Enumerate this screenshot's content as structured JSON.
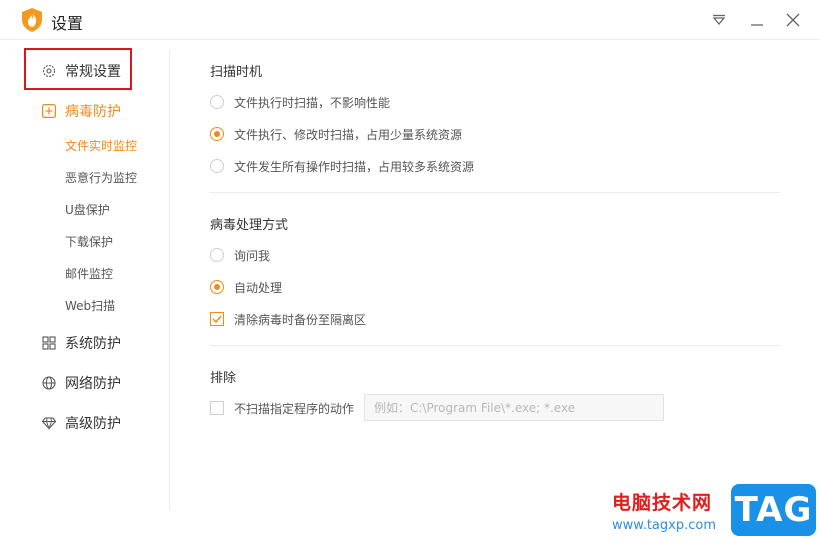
{
  "window": {
    "title": "设置"
  },
  "sidebar": {
    "general": "常规设置",
    "virus": "病毒防护",
    "sub_items": [
      "文件实时监控",
      "恶意行为监控",
      "U盘保护",
      "下载保护",
      "邮件监控",
      "Web扫描"
    ],
    "system": "系统防护",
    "network": "网络防护",
    "advanced": "高级防护"
  },
  "scan_timing": {
    "title": "扫描时机",
    "options": [
      {
        "label": "文件执行时扫描，不影响性能",
        "selected": false
      },
      {
        "label": "文件执行、修改时扫描，占用少量系统资源",
        "selected": true
      },
      {
        "label": "文件发生所有操作时扫描，占用较多系统资源",
        "selected": false
      }
    ]
  },
  "virus_handling": {
    "title": "病毒处理方式",
    "options": [
      {
        "label": "询问我",
        "selected": false
      },
      {
        "label": "自动处理",
        "selected": true
      }
    ],
    "backup_checkbox": {
      "label": "清除病毒时备份至隔离区",
      "checked": true
    }
  },
  "exclude": {
    "title": "排除",
    "checkbox": {
      "label": "不扫描指定程序的动作",
      "checked": false
    },
    "placeholder": "例如：C:\\Program File\\*.exe; *.exe"
  },
  "watermark": {
    "text": "电脑技术网",
    "url": "www.tagxp.com",
    "badge": "TAG"
  },
  "colors": {
    "accent": "#f08a1c",
    "highlight": "#d9161d"
  }
}
